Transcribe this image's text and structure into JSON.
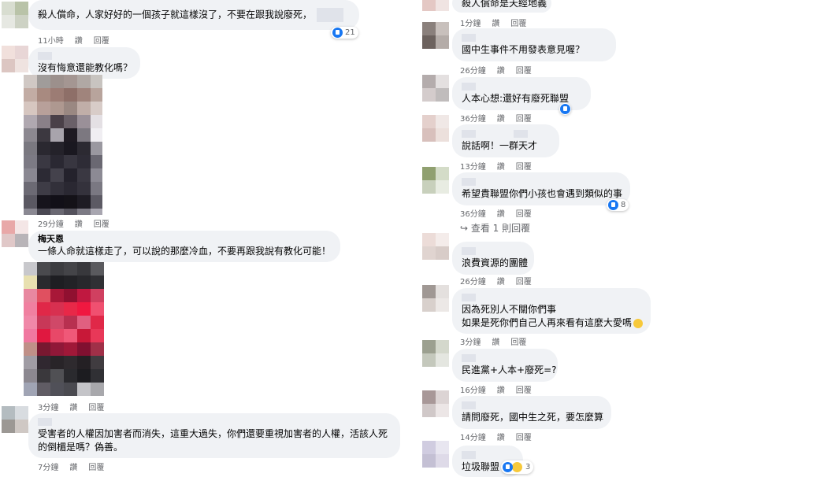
{
  "left": [
    {
      "name": "",
      "lines": [
        "殺人償命，人家好好的一個孩子就這樣沒了，不要在跟我說廢死，"
      ],
      "time": "11小時",
      "action1": "讚",
      "action2": "回覆",
      "reactions": "21"
    },
    {
      "name": "",
      "lines": [
        "沒有悔意還能教化嗎？"
      ],
      "time": "29分鐘",
      "action1": "讚",
      "action2": "回覆"
    },
    {
      "name": "梅天恩",
      "lines": [
        "一條人命就這樣走了，可以說的那麼冷血，不要再跟我說有教化可能！"
      ],
      "time": "3分鐘",
      "action1": "讚",
      "action2": "回覆"
    },
    {
      "name": "",
      "lines": [
        "受害者的人權因加害者而消失，這重大過失，你們還要重視加害者的人權，活該人死",
        "的倒楣是嗎？偽善。"
      ],
      "time": "7分鐘",
      "action1": "讚",
      "action2": "回覆"
    }
  ],
  "right": [
    {
      "lines": [
        "殺人償命是天經地義"
      ],
      "time": "1分鐘",
      "action1": "讚",
      "action2": "回覆"
    },
    {
      "lines": [
        "國中生事件不用發表意見喔？"
      ],
      "time": "26分鐘",
      "action1": "讚",
      "action2": "回覆"
    },
    {
      "lines": [
        "人本心想:還好有廢死聯盟"
      ],
      "time": "36分鐘",
      "action1": "讚",
      "action2": "回覆"
    },
    {
      "lines": [
        "說話啊！一群天才"
      ],
      "time": "13分鐘",
      "action1": "讚",
      "action2": "回覆"
    },
    {
      "lines": [
        "希望貴聯盟你們小孩也會遇到類似的事"
      ],
      "time": "36分鐘",
      "action1": "讚",
      "action2": "回覆",
      "reactions": "8",
      "view_replies": "↪ 查看 1 則回覆"
    },
    {
      "lines": [
        "浪費資源的團體"
      ],
      "time": "26分鐘",
      "action1": "讚",
      "action2": "回覆"
    },
    {
      "lines": [
        "因為死別人不關你們事",
        "如果是死你們自己人再來看有這麼大愛嗎"
      ],
      "time": "3分鐘",
      "action1": "讚",
      "action2": "回覆"
    },
    {
      "lines": [
        "民進黨+人本+廢死=?"
      ],
      "time": "16分鐘",
      "action1": "讚",
      "action2": "回覆"
    },
    {
      "lines": [
        "請問廢死，國中生之死，要怎麼算"
      ],
      "time": "14分鐘",
      "action1": "讚",
      "action2": "回覆"
    },
    {
      "lines": [
        "垃圾聯盟"
      ],
      "time": "",
      "action1": "",
      "action2": "",
      "reactions": "3"
    }
  ],
  "colors": {
    "bubble": "#f0f2f5",
    "meta": "#65676b",
    "like": "#1877f2"
  },
  "icons": {
    "like": "like-icon",
    "haha": "haha-icon",
    "reply_arrow": "reply-arrow-icon"
  }
}
